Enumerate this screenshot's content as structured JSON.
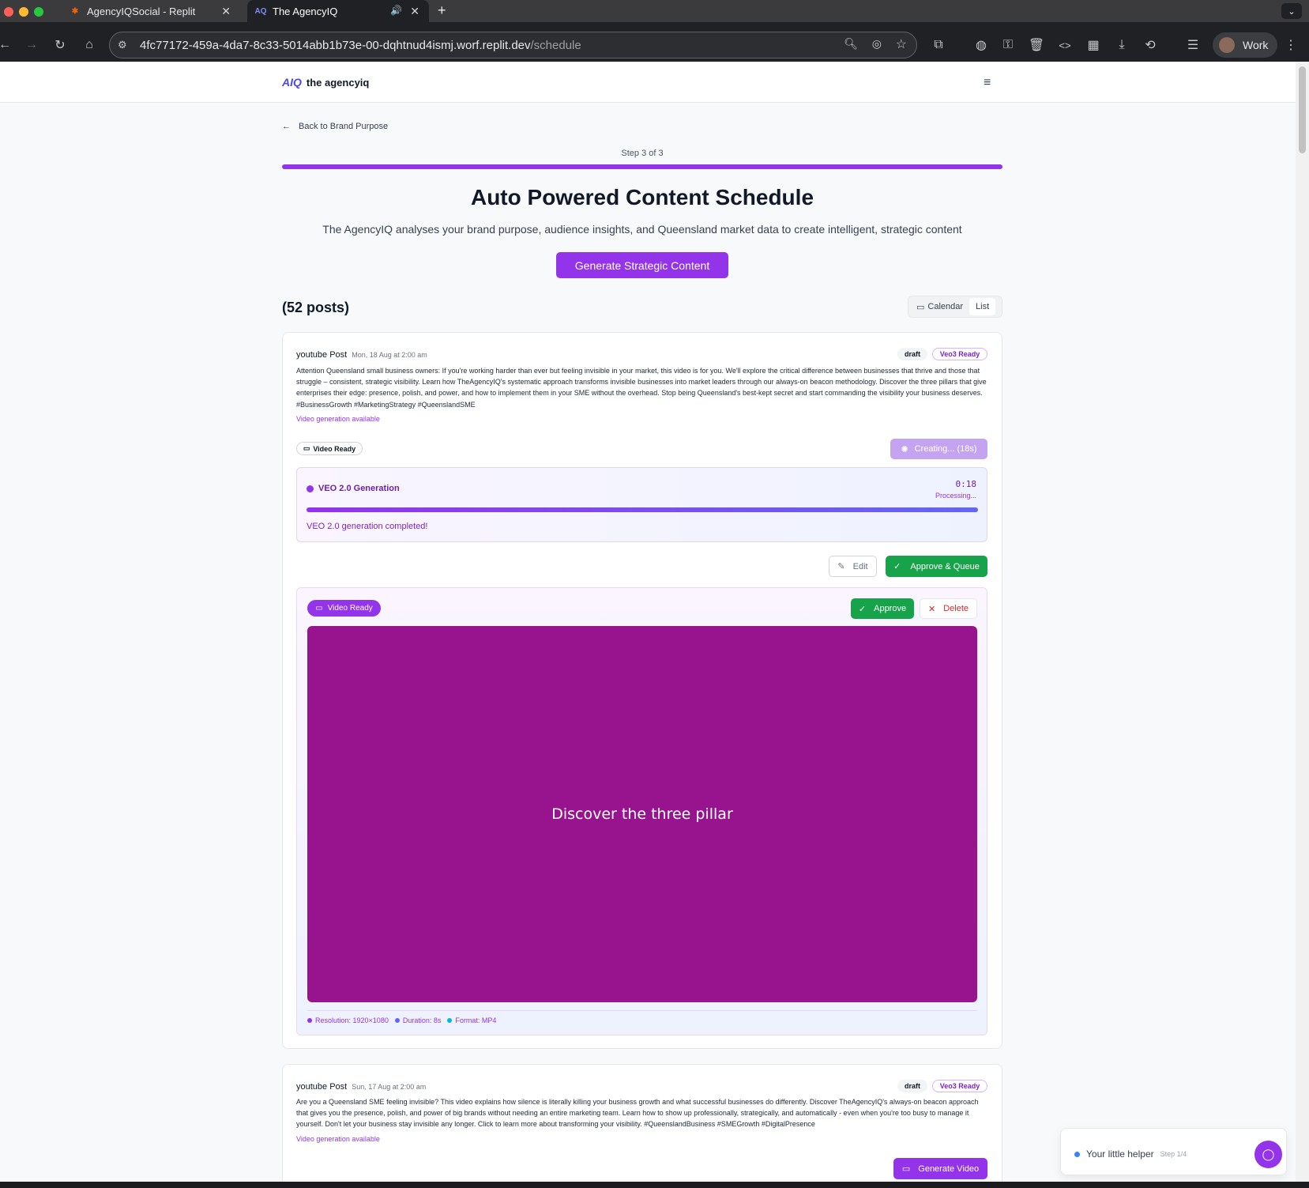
{
  "browser": {
    "tabs": [
      {
        "title": "AgencyIQSocial - Replit"
      },
      {
        "title": "The AgencyIQ"
      }
    ],
    "url_host": "4fc77172-459a-4da7-8c33-5014abb1b73e-00-dqhtnud4ismj.worf.replit.dev",
    "url_path": "/schedule",
    "profile": "Work"
  },
  "app": {
    "logo_mark": "AIQ",
    "logo_text": "the agencyiq"
  },
  "page": {
    "back_link": "Back to Brand Purpose",
    "step": "Step 3 of 3",
    "progress": 1.0,
    "title": "Auto Powered Content Schedule",
    "subtitle": "The AgencyIQ analyses your brand purpose, audience insights, and Queensland market data to create intelligent, strategic content",
    "generate_button": "Generate Strategic Content",
    "post_count": "(52 posts)",
    "view_toggle": {
      "calendar": "Calendar",
      "list": "List",
      "selected": "List"
    }
  },
  "posts": [
    {
      "type": "youtube Post",
      "date": "Mon, 18 Aug at 2:00 am",
      "status": "draft",
      "veo_badge": "Veo3 Ready",
      "body": "Attention Queensland small business owners: If you're working harder than ever but feeling invisible in your market, this video is for you. We'll explore the critical difference between businesses that thrive and those that struggle – consistent, strategic visibility. Learn how TheAgencyIQ's systematic approach transforms invisible businesses into market leaders through our always-on beacon methodology. Discover the three pillars that give enterprises their edge: presence, polish, and power, and how to implement them in your SME without the overhead. Stop being Queensland's best-kept secret and start commanding the visibility your business deserves. #BusinessGrowth #MarketingStrategy #QueenslandSME",
      "video_available": "Video generation available",
      "video_ready_chip": "Video Ready",
      "creating_button": "Creating... (18s)",
      "generation": {
        "title": "VEO 2.0 Generation",
        "time": "0:18",
        "state": "Processing...",
        "progress": 1.0,
        "message": "VEO 2.0 generation completed!"
      },
      "edit_button": "Edit",
      "approve_queue_button": "Approve & Queue",
      "video_panel": {
        "chip": "Video Ready",
        "approve_button": "Approve",
        "delete_button": "Delete",
        "caption": "Discover the three pillar",
        "resolution": "Resolution: 1920×1080",
        "duration": "Duration: 8s",
        "format": "Format: MP4"
      }
    },
    {
      "type": "youtube Post",
      "date": "Sun, 17 Aug at 2:00 am",
      "status": "draft",
      "veo_badge": "Veo3 Ready",
      "body": "Are you a Queensland SME feeling invisible? This video explains how silence is literally killing your business growth and what successful businesses do differently. Discover TheAgencyIQ's always-on beacon approach that gives you the presence, polish, and power of big brands without needing an entire marketing team. Learn how to show up professionally, strategically, and automatically - even when you're too busy to manage it yourself. Don't let your business stay invisible any longer. Click to learn more about transforming your visibility. #QueenslandBusiness #SMEGrowth #DigitalPresence",
      "video_available": "Video generation available",
      "generate_video_button": "Generate Video"
    }
  ],
  "helper": {
    "title": "Your little helper",
    "step": "Step 1/4"
  },
  "colors": {
    "accent": "#9333ea",
    "success": "#16a34a",
    "danger": "#dc2626",
    "video_bg": "#98148f"
  },
  "icons": [
    "back-arrow-icon",
    "calendar-icon",
    "video-camera-icon",
    "spinner-icon",
    "edit-icon",
    "check-icon",
    "x-icon",
    "chat-icon",
    "menu-icon"
  ]
}
